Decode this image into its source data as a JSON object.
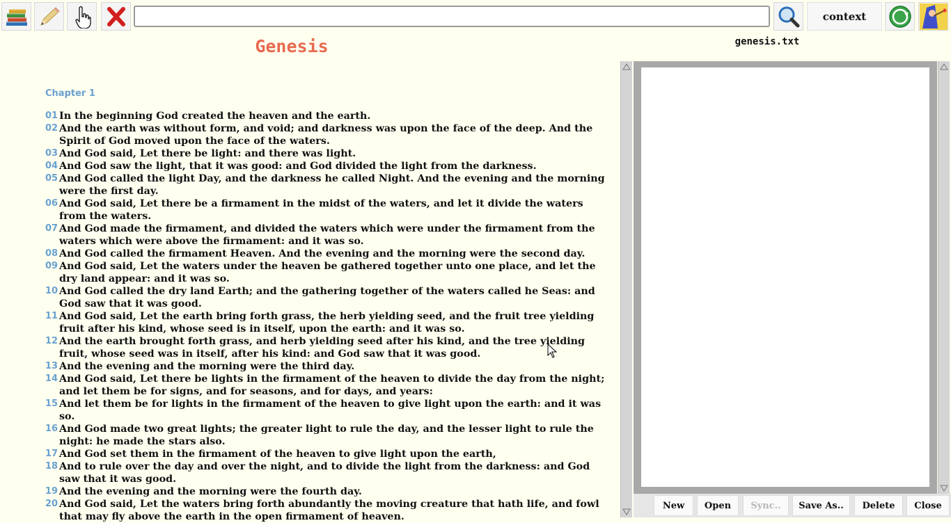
{
  "toolbar": {
    "icons": [
      "books-icon",
      "pencil-icon",
      "pointing-hand-icon",
      "close-icon",
      "magnifier-icon",
      "refresh-icon",
      "wizard-icon"
    ],
    "search_value": "",
    "context_label": "context"
  },
  "book": {
    "title": "Genesis",
    "chapter_label": "Chapter 1",
    "verses": [
      {
        "num": "01",
        "text": "In the beginning God created the heaven and the earth."
      },
      {
        "num": "02",
        "text": "And the earth was without form, and void; and darkness was upon the face of the deep. And the Spirit of God moved upon the face of the waters."
      },
      {
        "num": "03",
        "text": "And God said, Let there be light: and there was light."
      },
      {
        "num": "04",
        "text": "And God saw the light, that it was good: and God divided the light from the darkness."
      },
      {
        "num": "05",
        "text": "And God called the light Day, and the darkness he called Night. And the evening and the morning were the first day."
      },
      {
        "num": "06",
        "text": "And God said, Let there be a firmament in the midst of the waters, and let it divide the waters from the waters."
      },
      {
        "num": "07",
        "text": "And God made the firmament, and divided the waters which were under the firmament from the waters which were above the firmament: and it was so."
      },
      {
        "num": "08",
        "text": "And God called the firmament Heaven. And the evening and the morning were the second day."
      },
      {
        "num": "09",
        "text": "And God said, Let the waters under the heaven be gathered together unto one place, and let the dry land appear: and it was so."
      },
      {
        "num": "10",
        "text": "And God called the dry land Earth; and the gathering together of the waters called he Seas: and God saw that it was good."
      },
      {
        "num": "11",
        "text": "And God said, Let the earth bring forth grass, the herb yielding seed, and the fruit tree yielding fruit after his kind, whose seed is in itself, upon the earth: and it was so."
      },
      {
        "num": "12",
        "text": "And the earth brought forth grass, and herb yielding seed after his kind, and the tree yielding fruit, whose seed was in itself, after his kind: and God saw that it was good."
      },
      {
        "num": "13",
        "text": "And the evening and the morning were the third day."
      },
      {
        "num": "14",
        "text": "And God said, Let there be lights in the firmament of the heaven to divide the day from the night; and let them be for signs, and for seasons, and for days, and years:"
      },
      {
        "num": "15",
        "text": "And let them be for lights in the firmament of the heaven to give light upon the earth: and it was so."
      },
      {
        "num": "16",
        "text": "And God made two great lights; the greater light to rule the day, and the lesser light to rule the night: he made the stars also."
      },
      {
        "num": "17",
        "text": "And God set them in the firmament of the heaven to give light upon the earth,"
      },
      {
        "num": "18",
        "text": "And to rule over the day and over the night, and to divide the light from the darkness: and God saw that it was good."
      },
      {
        "num": "19",
        "text": "And the evening and the morning were the fourth day."
      },
      {
        "num": "20",
        "text": "And God said, Let the waters bring forth abundantly the moving creature that hath life, and fowl that may fly above the earth in the open firmament of heaven."
      }
    ]
  },
  "file_panel": {
    "file_name": "genesis.txt",
    "content": "",
    "buttons": {
      "new": "New",
      "open": "Open",
      "sync": "Sync..",
      "save_as": "Save As..",
      "delete": "Delete",
      "close": "Close"
    }
  },
  "colors": {
    "background": "#fffff0",
    "title": "#e86a4f",
    "verse_number": "#6aa1d0"
  }
}
